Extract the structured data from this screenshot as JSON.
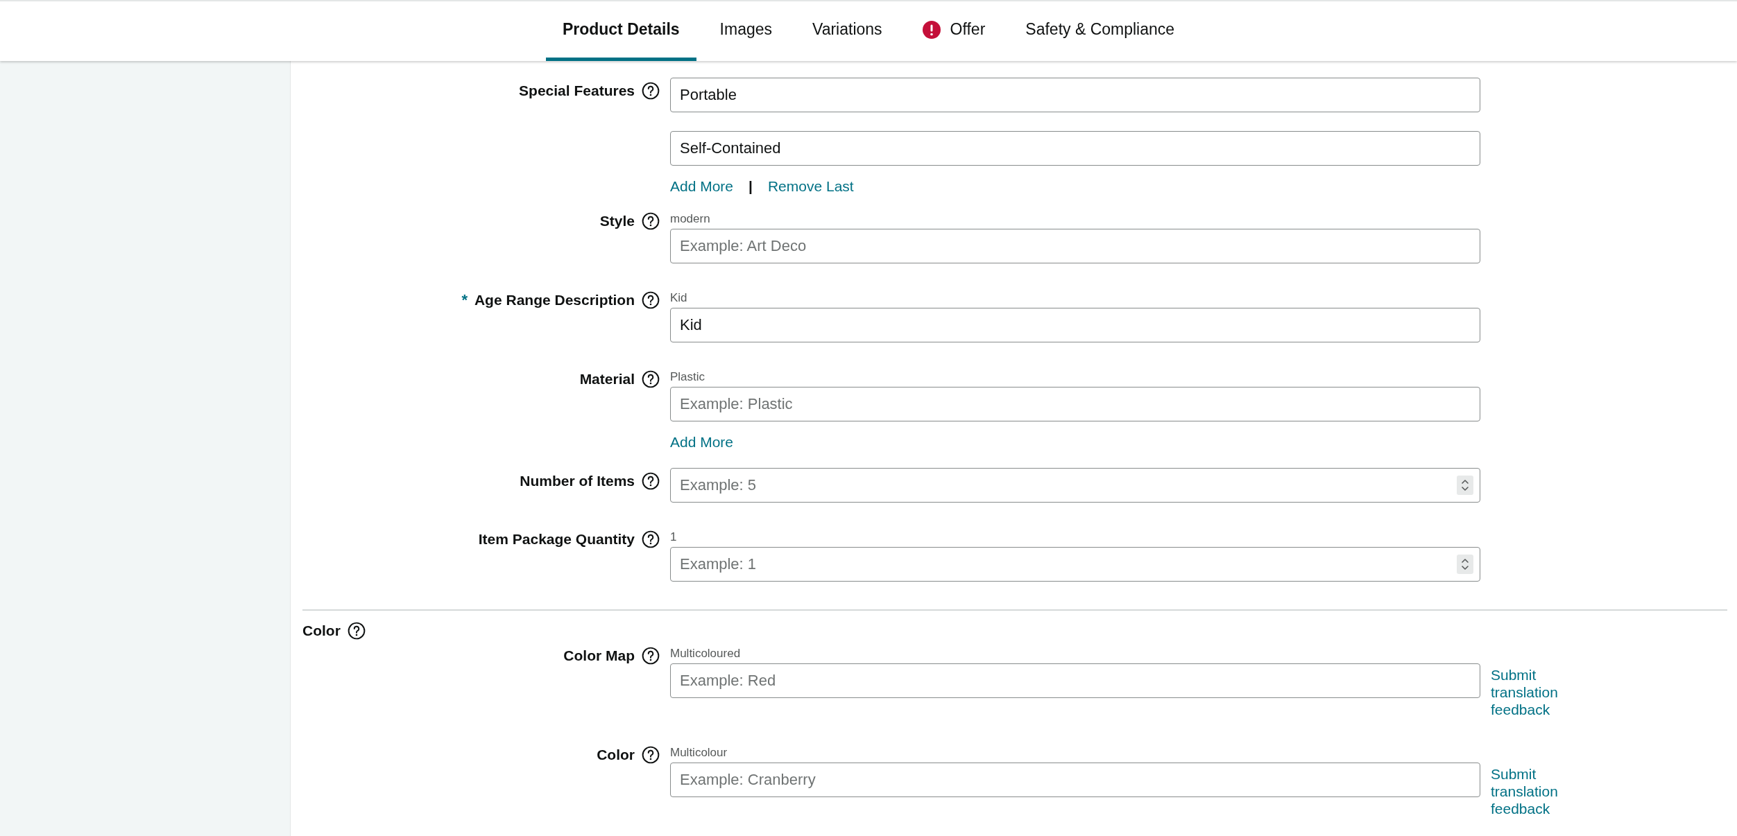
{
  "tabs": [
    {
      "label": "Product Details",
      "selected": true,
      "alert": false
    },
    {
      "label": "Images",
      "selected": false,
      "alert": false
    },
    {
      "label": "Variations",
      "selected": false,
      "alert": false
    },
    {
      "label": "Offer",
      "selected": false,
      "alert": true
    },
    {
      "label": "Safety & Compliance",
      "selected": false,
      "alert": false
    }
  ],
  "sections": [
    {
      "fields": [
        {
          "label": "Special Features",
          "kind": "text",
          "inputs": [
            {
              "value": "Portable"
            },
            {
              "value": "Self-Contained"
            }
          ],
          "actions": [
            "Add More",
            "Remove Last"
          ],
          "action_separator": "|"
        },
        {
          "label": "Style",
          "kind": "text",
          "hint": "modern",
          "inputs": [
            {
              "placeholder": "Example: Art Deco"
            }
          ]
        },
        {
          "label": "Age Range Description",
          "required_mark": "*",
          "kind": "text",
          "hint": "Kid",
          "inputs": [
            {
              "value": "Kid"
            }
          ]
        },
        {
          "label": "Material",
          "kind": "text",
          "hint": "Plastic",
          "inputs": [
            {
              "placeholder": "Example: Plastic"
            }
          ],
          "actions": [
            "Add More"
          ]
        },
        {
          "label": "Number of Items",
          "kind": "number",
          "inputs": [
            {
              "placeholder": "Example: 5"
            }
          ]
        },
        {
          "label": "Item Package Quantity",
          "kind": "number",
          "hint": "1",
          "inputs": [
            {
              "placeholder": "Example: 1"
            }
          ]
        }
      ]
    },
    {
      "title": "Color",
      "fields": [
        {
          "label": "Color Map",
          "kind": "text",
          "hint": "Multicoloured",
          "inputs": [
            {
              "placeholder": "Example: Red"
            }
          ],
          "side_link": "Submit translation feedback"
        },
        {
          "label": "Color",
          "kind": "text",
          "hint": "Multicolour",
          "inputs": [
            {
              "placeholder": "Example: Cranberry"
            }
          ],
          "side_link": "Submit translation feedback"
        }
      ]
    }
  ]
}
